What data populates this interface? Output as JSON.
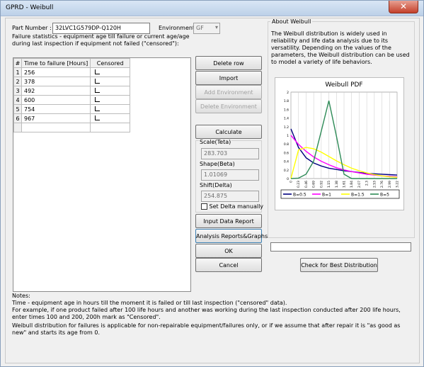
{
  "window": {
    "title": "GPRD - Weibull",
    "close_glyph": "✕"
  },
  "form": {
    "part_number_label": "Part Number :",
    "part_number_value": "32LVC1G579DP-Q120H",
    "environment_label": "Environment :",
    "environment_value": "GF",
    "failure_stats_text": "Failure statistics - equipment age till failure or current age/age during last inspection if equipment not failed (\"censored\"):"
  },
  "table": {
    "headers": [
      "#",
      "Time to failure [Hours]",
      "Censored"
    ],
    "rows": [
      {
        "n": "1",
        "time": "256"
      },
      {
        "n": "2",
        "time": "378"
      },
      {
        "n": "3",
        "time": "492"
      },
      {
        "n": "4",
        "time": "600"
      },
      {
        "n": "5",
        "time": "754"
      },
      {
        "n": "6",
        "time": "967"
      }
    ]
  },
  "buttons": {
    "delete_row": "Delete row",
    "import": "Import",
    "add_environment": "Add Environment",
    "delete_environment": "Delete Environment",
    "calculate": "Calculate",
    "input_data_report": "Input Data Report",
    "analysis_reports": "Analysis Reports&Graphs",
    "ok": "OK",
    "cancel": "Cancel",
    "check_best_distribution": "Check for Best Distribution"
  },
  "params": {
    "scale_label": "Scale(Teta)",
    "scale_value": "283.703",
    "shape_label": "Shape(Beta)",
    "shape_value": "1.01069",
    "shift_label": "Shift(Delta)",
    "shift_value": "254.875",
    "set_delta_label": "Set Delta manually"
  },
  "about": {
    "title": "About Weibull",
    "text": "The Weibull distribution is widely used in reliability and life data analysis due to its versatility. Depending on the values of the parameters, the Weibull distribution can be used to model a variety of life behaviors."
  },
  "chart_data": {
    "type": "line",
    "title": "Weibull PDF",
    "xlabel": "",
    "ylabel": "",
    "ylim": [
      0,
      2
    ],
    "y_ticks": [
      "0",
      "0.2",
      "0.4",
      "0.6",
      "0.8",
      "1",
      "1.2",
      "1.4",
      "1.6",
      "1.8",
      "2"
    ],
    "x": [
      0,
      0.23,
      0.46,
      0.69,
      0.92,
      1.15,
      1.38,
      1.61,
      1.84,
      2.07,
      2.3,
      2.53,
      2.76,
      2.99,
      3.22
    ],
    "x_ticks": [
      "0",
      "0.23",
      "0.46",
      "0.69",
      "0.92",
      "1.15",
      "1.38",
      "1.61",
      "1.84",
      "2.07",
      "2.3",
      "2.53",
      "2.76",
      "2.99",
      "3.22"
    ],
    "series": [
      {
        "name": "B=0.5",
        "color": "#00007f",
        "values": [
          1.15,
          0.72,
          0.48,
          0.36,
          0.29,
          0.24,
          0.21,
          0.18,
          0.16,
          0.14,
          0.12,
          0.11,
          0.1,
          0.09,
          0.08
        ]
      },
      {
        "name": "B=1",
        "color": "#ff00ff",
        "values": [
          1.0,
          0.79,
          0.63,
          0.5,
          0.4,
          0.32,
          0.25,
          0.2,
          0.16,
          0.13,
          0.1,
          0.08,
          0.06,
          0.05,
          0.04
        ]
      },
      {
        "name": "B=1.5",
        "color": "#ffff00",
        "values": [
          0,
          0.66,
          0.72,
          0.69,
          0.61,
          0.51,
          0.41,
          0.32,
          0.24,
          0.18,
          0.13,
          0.09,
          0.06,
          0.04,
          0.03
        ]
      },
      {
        "name": "B=5",
        "color": "#2e8b57",
        "values": [
          0,
          0.01,
          0.1,
          0.4,
          1.1,
          1.8,
          0.98,
          0.1,
          0.0,
          0.0,
          0.0,
          0.0,
          0.0,
          0.0,
          0.0
        ]
      }
    ],
    "legend_position": "bottom"
  },
  "notes": {
    "title": "Notes:",
    "line1": "Time - equipment age in hours till the moment it is failed or till last inspection (\"censored\" data).",
    "line2": "For example, if one product failed after 100 life hours and another was working during the last inspection conducted after 200 life hours, enter times 100 and 200, 200h mark as \"Censored\".",
    "line3": "Weibull distribution for failures is applicable for non-repairable equipment/failures only, or if we assume that after repair it is \"as good as new\" and starts its age from 0."
  }
}
